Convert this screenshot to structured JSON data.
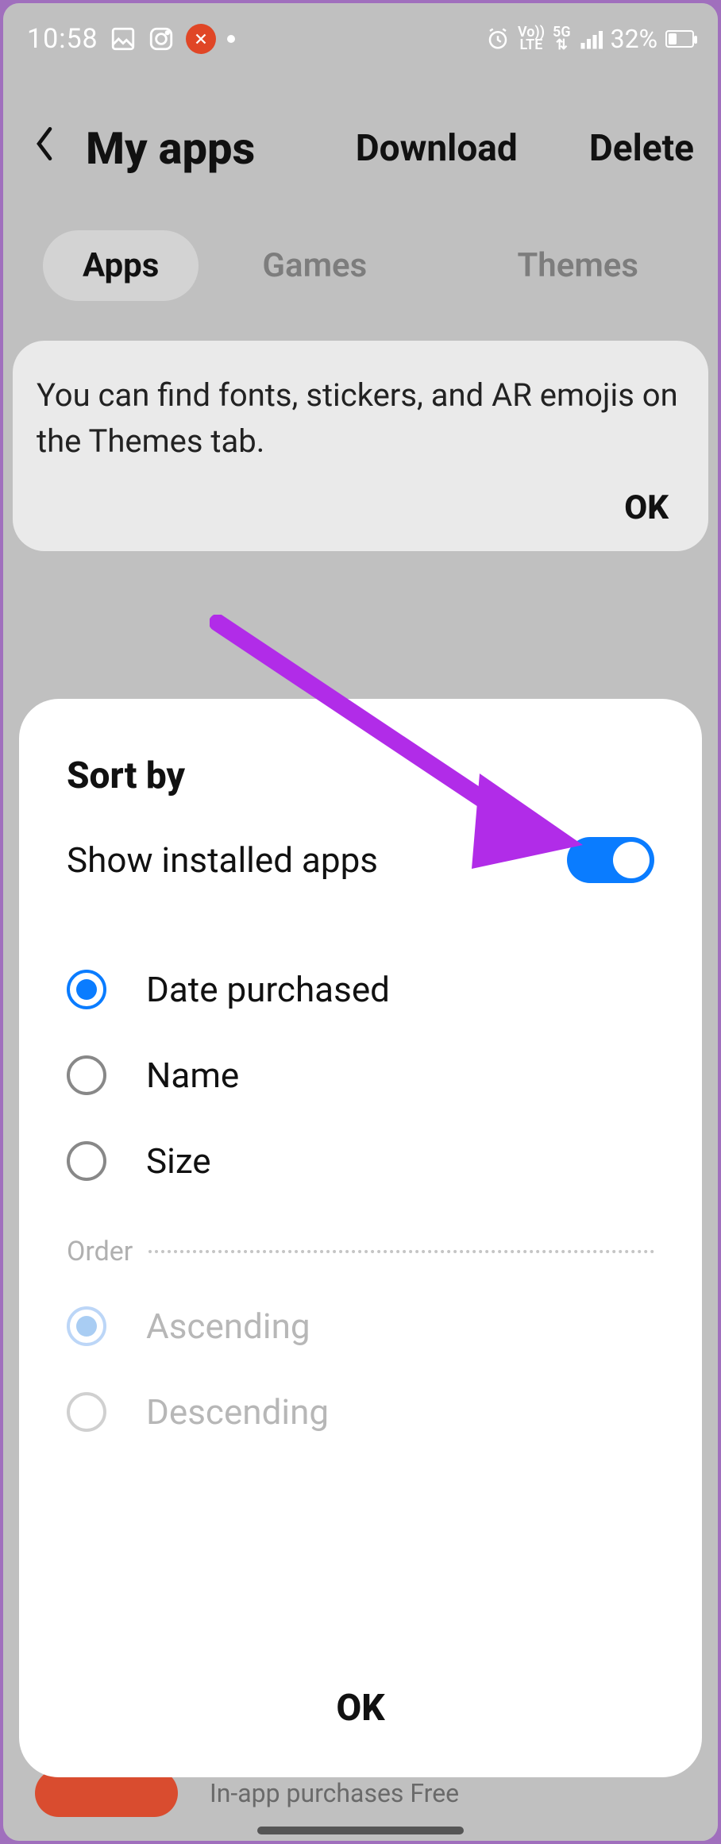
{
  "status": {
    "time": "10:58",
    "battery_pct": "32%",
    "lte_label": "Vo))\nLTE",
    "net_label": "5G"
  },
  "header": {
    "title": "My apps",
    "download": "Download",
    "delete": "Delete"
  },
  "tabs": [
    {
      "label": "Apps",
      "active": true
    },
    {
      "label": "Games",
      "active": false
    },
    {
      "label": "Themes",
      "active": false
    }
  ],
  "info": {
    "text": "You can find fonts, stickers, and AR emojis on the Themes tab.",
    "ok": "OK"
  },
  "peek": {
    "text": "In-app purchases Free"
  },
  "sheet": {
    "title": "Sort by",
    "toggle_label": "Show installed apps",
    "toggle_on": true,
    "sort_options": [
      {
        "key": "date",
        "label": "Date purchased",
        "selected": true
      },
      {
        "key": "name",
        "label": "Name",
        "selected": false
      },
      {
        "key": "size",
        "label": "Size",
        "selected": false
      }
    ],
    "order_label": "Order",
    "order_options": [
      {
        "key": "asc",
        "label": "Ascending",
        "selected": true,
        "disabled": true
      },
      {
        "key": "desc",
        "label": "Descending",
        "selected": false,
        "disabled": true
      }
    ],
    "ok": "OK"
  },
  "annotation": {
    "arrow_color": "#B12CE8"
  }
}
